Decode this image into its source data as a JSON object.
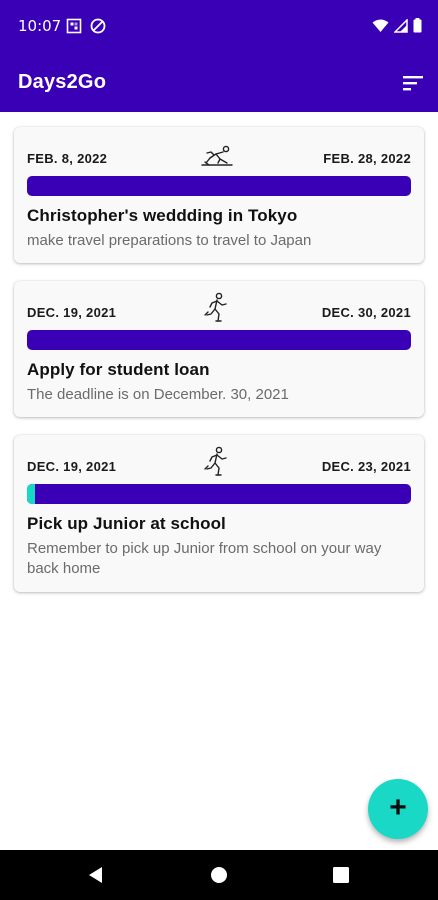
{
  "status_bar": {
    "time": "10:07",
    "icons": [
      "sim-icon",
      "data-saver-icon",
      "wifi-icon",
      "signal-icon",
      "battery-icon"
    ]
  },
  "app_bar": {
    "title": "Days2Go",
    "sort_icon": "sort-icon"
  },
  "events": [
    {
      "start_date": "FEB. 8, 2022",
      "end_date": "FEB. 28, 2022",
      "runner_pose": "start",
      "progress": 0.0,
      "title": "Christopher's weddding in Tokyo",
      "description": "make travel preparations to travel to Japan"
    },
    {
      "start_date": "DEC. 19, 2021",
      "end_date": "DEC. 30, 2021",
      "runner_pose": "running",
      "progress": 0.0,
      "title": "Apply for student loan",
      "description": "The deadline is on December. 30, 2021"
    },
    {
      "start_date": "DEC. 19, 2021",
      "end_date": "DEC. 23, 2021",
      "runner_pose": "running",
      "progress": 0.02,
      "title": "Pick up Junior at school",
      "description": "Remember to pick up Junior from school on your way back home"
    }
  ],
  "fab": {
    "label": "+"
  },
  "colors": {
    "primary": "#3a00b5",
    "accent": "#19d8c6",
    "progress_remaining": "#3a00b5",
    "progress_elapsed": "#17d8c4"
  },
  "nav": {
    "back": "back-icon",
    "home": "home-icon",
    "recents": "recents-icon"
  }
}
